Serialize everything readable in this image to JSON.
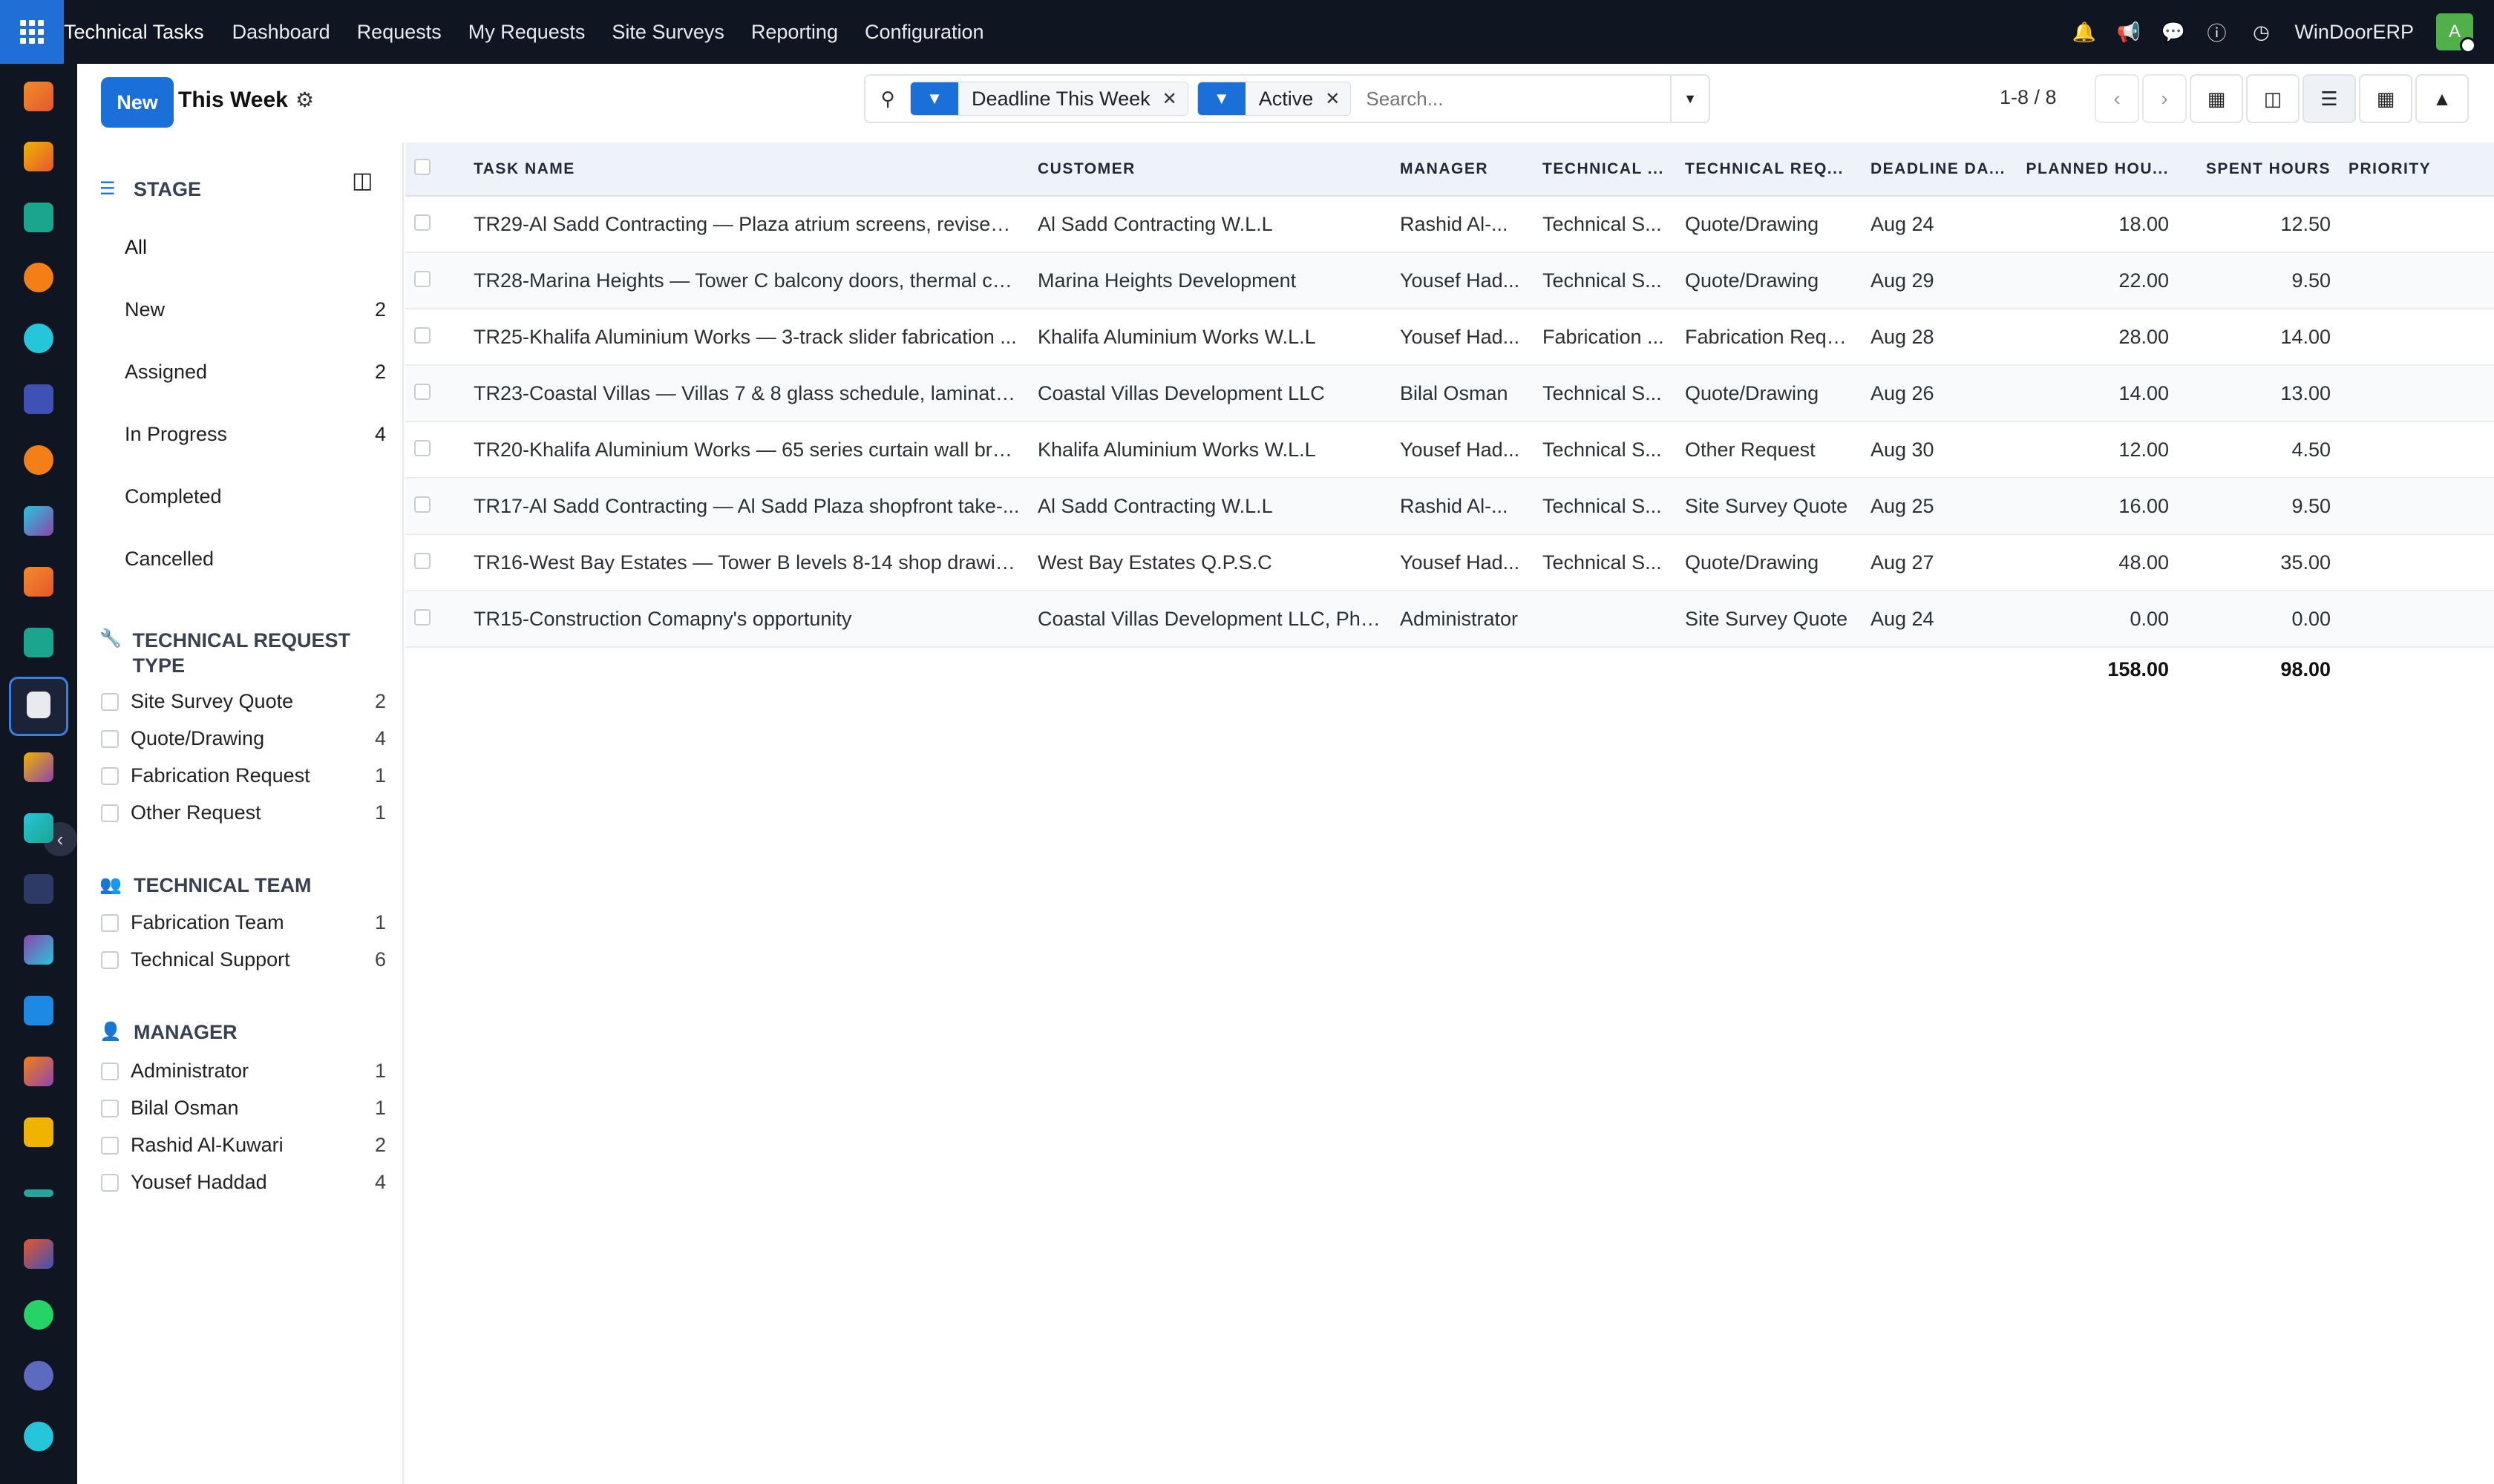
{
  "navbar": {
    "brand": "Technical Tasks",
    "menu": [
      "Dashboard",
      "Requests",
      "My Requests",
      "Site Surveys",
      "Reporting",
      "Configuration"
    ],
    "company": "WinDoorERP",
    "avatar_letter": "A"
  },
  "control": {
    "new_label": "New",
    "view_title": "This Week",
    "facets": [
      "Deadline This Week",
      "Active"
    ],
    "search_placeholder": "Search...",
    "pager": "1-8 / 8"
  },
  "sidebar": {
    "stage": {
      "title": "STAGE",
      "items": [
        {
          "label": "All",
          "count": ""
        },
        {
          "label": "New",
          "count": "2"
        },
        {
          "label": "Assigned",
          "count": "2"
        },
        {
          "label": "In Progress",
          "count": "4"
        },
        {
          "label": "Completed",
          "count": ""
        },
        {
          "label": "Cancelled",
          "count": ""
        }
      ]
    },
    "request_type": {
      "title": "TECHNICAL REQUEST TYPE",
      "items": [
        {
          "label": "Site Survey Quote",
          "count": "2"
        },
        {
          "label": "Quote/Drawing",
          "count": "4"
        },
        {
          "label": "Fabrication Request",
          "count": "1"
        },
        {
          "label": "Other Request",
          "count": "1"
        }
      ]
    },
    "team": {
      "title": "TECHNICAL TEAM",
      "items": [
        {
          "label": "Fabrication Team",
          "count": "1"
        },
        {
          "label": "Technical Support",
          "count": "6"
        }
      ]
    },
    "manager": {
      "title": "MANAGER",
      "items": [
        {
          "label": "Administrator",
          "count": "1"
        },
        {
          "label": "Bilal Osman",
          "count": "1"
        },
        {
          "label": "Rashid Al-Kuwari",
          "count": "2"
        },
        {
          "label": "Yousef Haddad",
          "count": "4"
        }
      ]
    }
  },
  "table": {
    "columns": [
      "TASK NAME",
      "CUSTOMER",
      "MANAGER",
      "TECHNICAL ...",
      "TECHNICAL REQ...",
      "DEADLINE DA...",
      "PLANNED HOU...",
      "SPENT HOURS",
      "PRIORITY"
    ],
    "rows": [
      [
        "TR29-Al Sadd Contracting — Plaza atrium screens, revised ...",
        "Al Sadd Contracting W.L.L",
        "Rashid Al-...",
        "Technical S...",
        "Quote/Drawing",
        "Aug 24",
        "18.00",
        "12.50"
      ],
      [
        "TR28-Marina Heights — Tower C balcony doors, thermal cal...",
        "Marina Heights Development",
        "Yousef Had...",
        "Technical S...",
        "Quote/Drawing",
        "Aug 29",
        "22.00",
        "9.50"
      ],
      [
        "TR25-Khalifa Aluminium Works — 3-track slider fabrication ...",
        "Khalifa Aluminium Works W.L.L",
        "Yousef Had...",
        "Fabrication ...",
        "Fabrication Requ...",
        "Aug 28",
        "28.00",
        "14.00"
      ],
      [
        "TR23-Coastal Villas — Villas 7 & 8 glass schedule, laminate...",
        "Coastal Villas Development LLC",
        "Bilal Osman",
        "Technical S...",
        "Quote/Drawing",
        "Aug 26",
        "14.00",
        "13.00"
      ],
      [
        "TR20-Khalifa Aluminium Works — 65 series curtain wall bra...",
        "Khalifa Aluminium Works W.L.L",
        "Yousef Had...",
        "Technical S...",
        "Other Request",
        "Aug 30",
        "12.00",
        "4.50"
      ],
      [
        "TR17-Al Sadd Contracting — Al Sadd Plaza shopfront take-...",
        "Al Sadd Contracting W.L.L",
        "Rashid Al-...",
        "Technical S...",
        "Site Survey Quote",
        "Aug 25",
        "16.00",
        "9.50"
      ],
      [
        "TR16-West Bay Estates — Tower B levels 8-14 shop drawin...",
        "West Bay Estates Q.P.S.C",
        "Yousef Had...",
        "Technical S...",
        "Quote/Drawing",
        "Aug 27",
        "48.00",
        "35.00"
      ],
      [
        "TR15-Construction Comapny's opportunity",
        "Coastal Villas Development LLC, Phili...",
        "Administrator",
        "",
        "Site Survey Quote",
        "Aug 24",
        "0.00",
        "0.00"
      ]
    ],
    "totals": {
      "planned": "158.00",
      "spent": "98.00"
    }
  },
  "icons": {
    "apps": "apps-grid-icon",
    "search": "search-icon",
    "filter": "filter-icon",
    "settings": "gear-icon"
  }
}
